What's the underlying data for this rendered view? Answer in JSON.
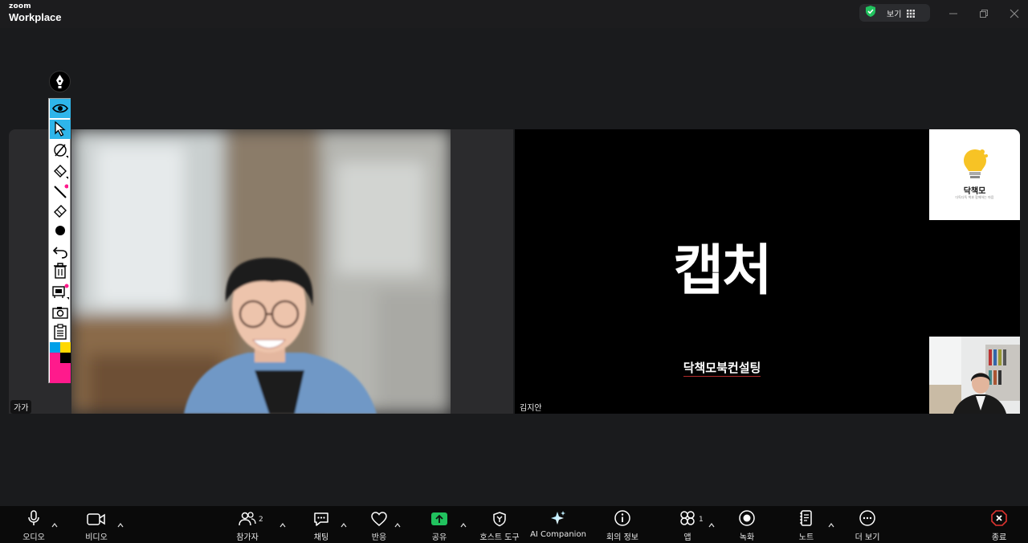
{
  "window": {
    "brand_top": "zoom",
    "brand_bottom": "Workplace",
    "view_label": "보기",
    "controls": [
      "minimize-icon",
      "restore-icon",
      "close-icon"
    ]
  },
  "participants": {
    "left_name": "가가",
    "right_name": "김지안"
  },
  "slide": {
    "title": "캡처",
    "subtitle": "닥책모북컨설팅",
    "logo_name": "닥책모",
    "logo_tagline": "다독다독 책과 함께하는 마음"
  },
  "annotation_tools": [
    "eye-icon",
    "pointer-icon",
    "pen-icon",
    "highlighter-icon",
    "line-icon",
    "eraser-icon",
    "dot-icon",
    "undo-icon",
    "trash-icon",
    "stamp-icon",
    "camera-icon",
    "clipboard-icon"
  ],
  "colors": {
    "accent_blue": "#2eb5ea",
    "share_green": "#21c25e",
    "end_red": "#e0332f",
    "swatch_cyan": "#00a0e8",
    "swatch_yellow": "#ffd800",
    "swatch_magenta": "#ff1a8c",
    "swatch_black": "#000000"
  },
  "toolbar": {
    "audio": "오디오",
    "video": "비디오",
    "participants": "참가자",
    "participants_count": "2",
    "chat": "채팅",
    "reactions": "반응",
    "share": "공유",
    "host_tools": "호스트 도구",
    "ai_companion": "AI Companion",
    "meeting_info": "회의 정보",
    "apps": "앱",
    "apps_count": "1",
    "record": "녹화",
    "notes": "노트",
    "more": "더 보기",
    "end": "종료"
  }
}
